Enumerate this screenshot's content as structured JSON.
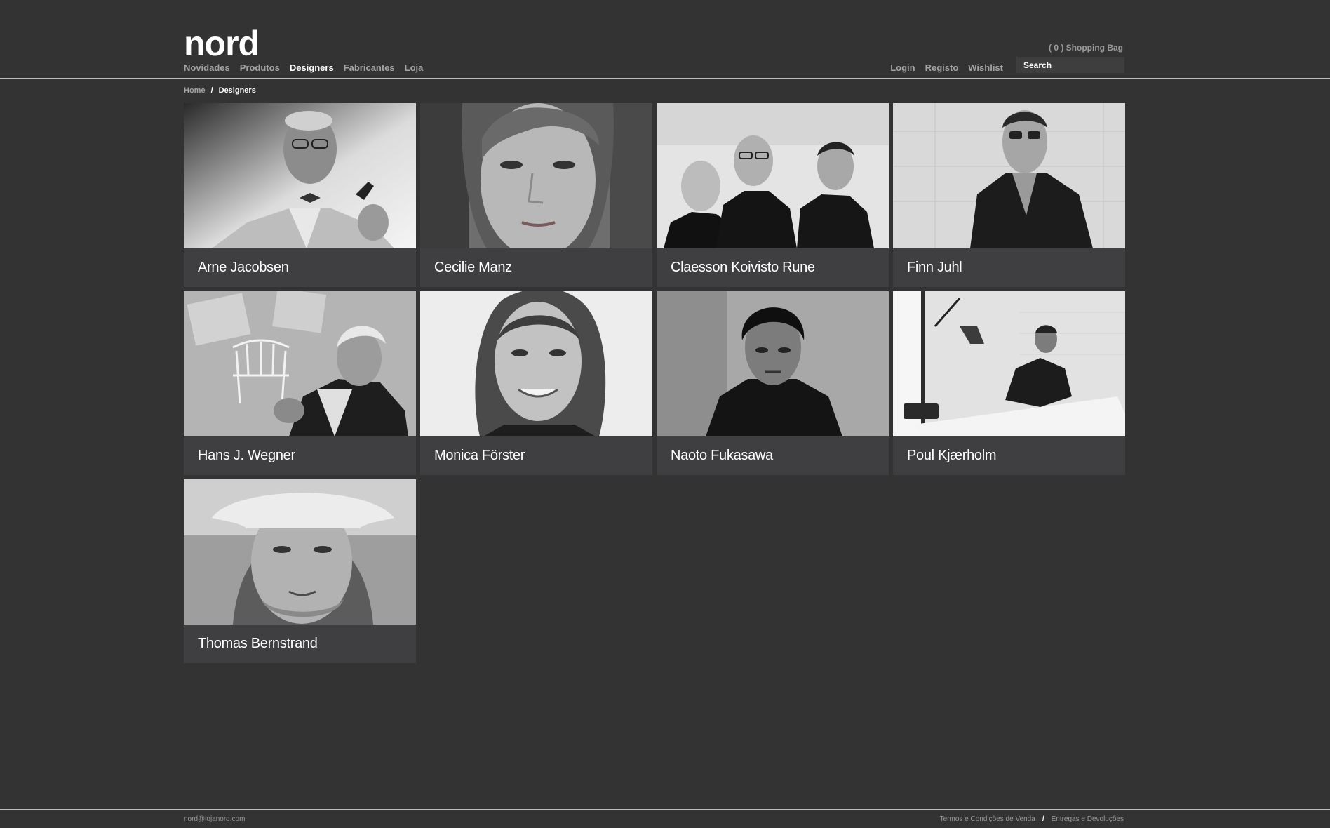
{
  "brand": {
    "logo": "nord"
  },
  "main_nav": [
    {
      "label": "Novidades",
      "active": false
    },
    {
      "label": "Produtos",
      "active": false
    },
    {
      "label": "Designers",
      "active": true
    },
    {
      "label": "Fabricantes",
      "active": false
    },
    {
      "label": "Loja",
      "active": false
    }
  ],
  "header": {
    "shopping_bag": "( 0 ) Shopping Bag",
    "user_nav": [
      "Login",
      "Registo",
      "Wishlist"
    ],
    "search_placeholder": "Search"
  },
  "breadcrumb": {
    "home": "Home",
    "separator": "/",
    "current": "Designers"
  },
  "designers": [
    {
      "name": "Arne Jacobsen"
    },
    {
      "name": "Cecilie Manz"
    },
    {
      "name": "Claesson Koivisto Rune"
    },
    {
      "name": "Finn Juhl"
    },
    {
      "name": "Hans J. Wegner"
    },
    {
      "name": "Monica Förster"
    },
    {
      "name": "Naoto Fukasawa"
    },
    {
      "name": "Poul Kjærholm"
    },
    {
      "name": "Thomas Bernstrand"
    }
  ],
  "footer": {
    "email": "nord@lojanord.com",
    "links": [
      "Termos e Condições de Venda",
      "Entregas e Devoluções"
    ],
    "separator": "/"
  },
  "colors": {
    "background": "#333333",
    "card": "#3f3f41",
    "nav_text": "#a3a3a3",
    "active_text": "#ffffff"
  }
}
